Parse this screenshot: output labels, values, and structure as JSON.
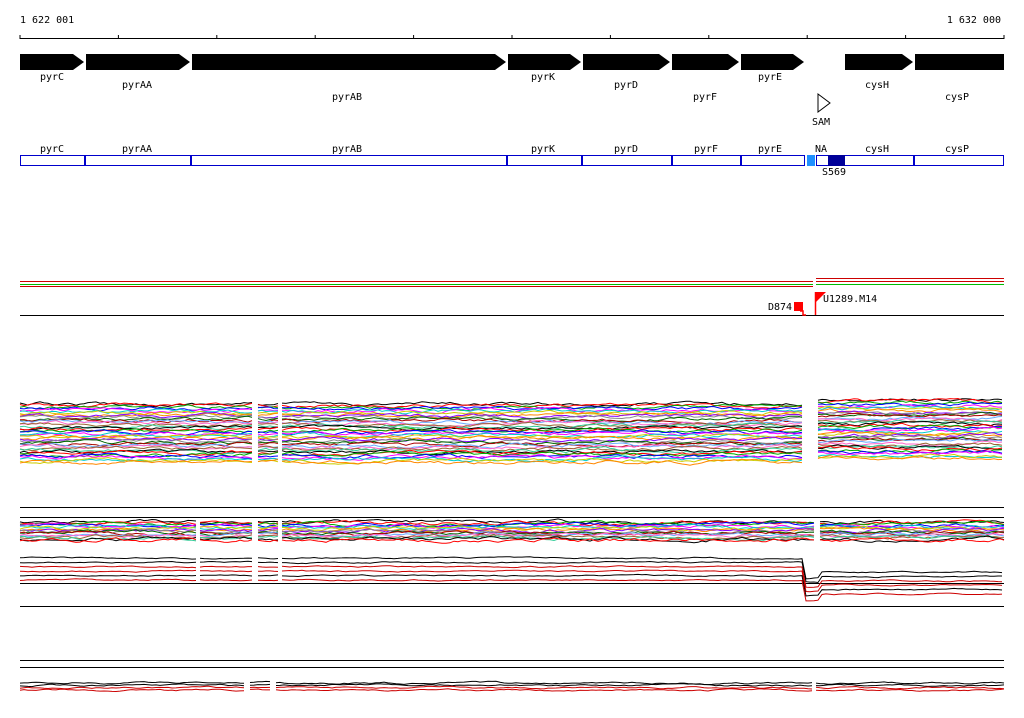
{
  "ruler": {
    "start_label": "1 622 001",
    "end_label": "1 632 000",
    "start": 1622001,
    "end": 1632000
  },
  "colors": {
    "gene_arrow": "#000000",
    "segment_outline": "#0000cc",
    "segment_na_light": "#1e90ff",
    "segment_dark": "#000099",
    "marker_red": "#ff0000",
    "line_red": "#cc0000",
    "line_green": "#00bb00"
  },
  "genes": [
    {
      "name": "pyrC"
    },
    {
      "name": "pyrAA"
    },
    {
      "name": "pyrAB"
    },
    {
      "name": "pyrK"
    },
    {
      "name": "pyrD"
    },
    {
      "name": "pyrF"
    },
    {
      "name": "pyrE"
    },
    {
      "name": "cysH"
    },
    {
      "name": "cysP"
    }
  ],
  "riboswitch": {
    "label": "SAM",
    "icon": "triangle-outline-icon"
  },
  "segments": [
    {
      "label": "pyrC"
    },
    {
      "label": "pyrAA"
    },
    {
      "label": "pyrAB"
    },
    {
      "label": "pyrK"
    },
    {
      "label": "pyrD"
    },
    {
      "label": "pyrF"
    },
    {
      "label": "pyrE"
    },
    {
      "label": "NA"
    },
    {
      "label": "cysH"
    },
    {
      "label": "cysP"
    }
  ],
  "segment_note": "S569",
  "markers": [
    {
      "label": "D874",
      "icon": "red-block-icon"
    },
    {
      "label": "U1289.M14",
      "icon": "red-flag-icon"
    }
  ]
}
